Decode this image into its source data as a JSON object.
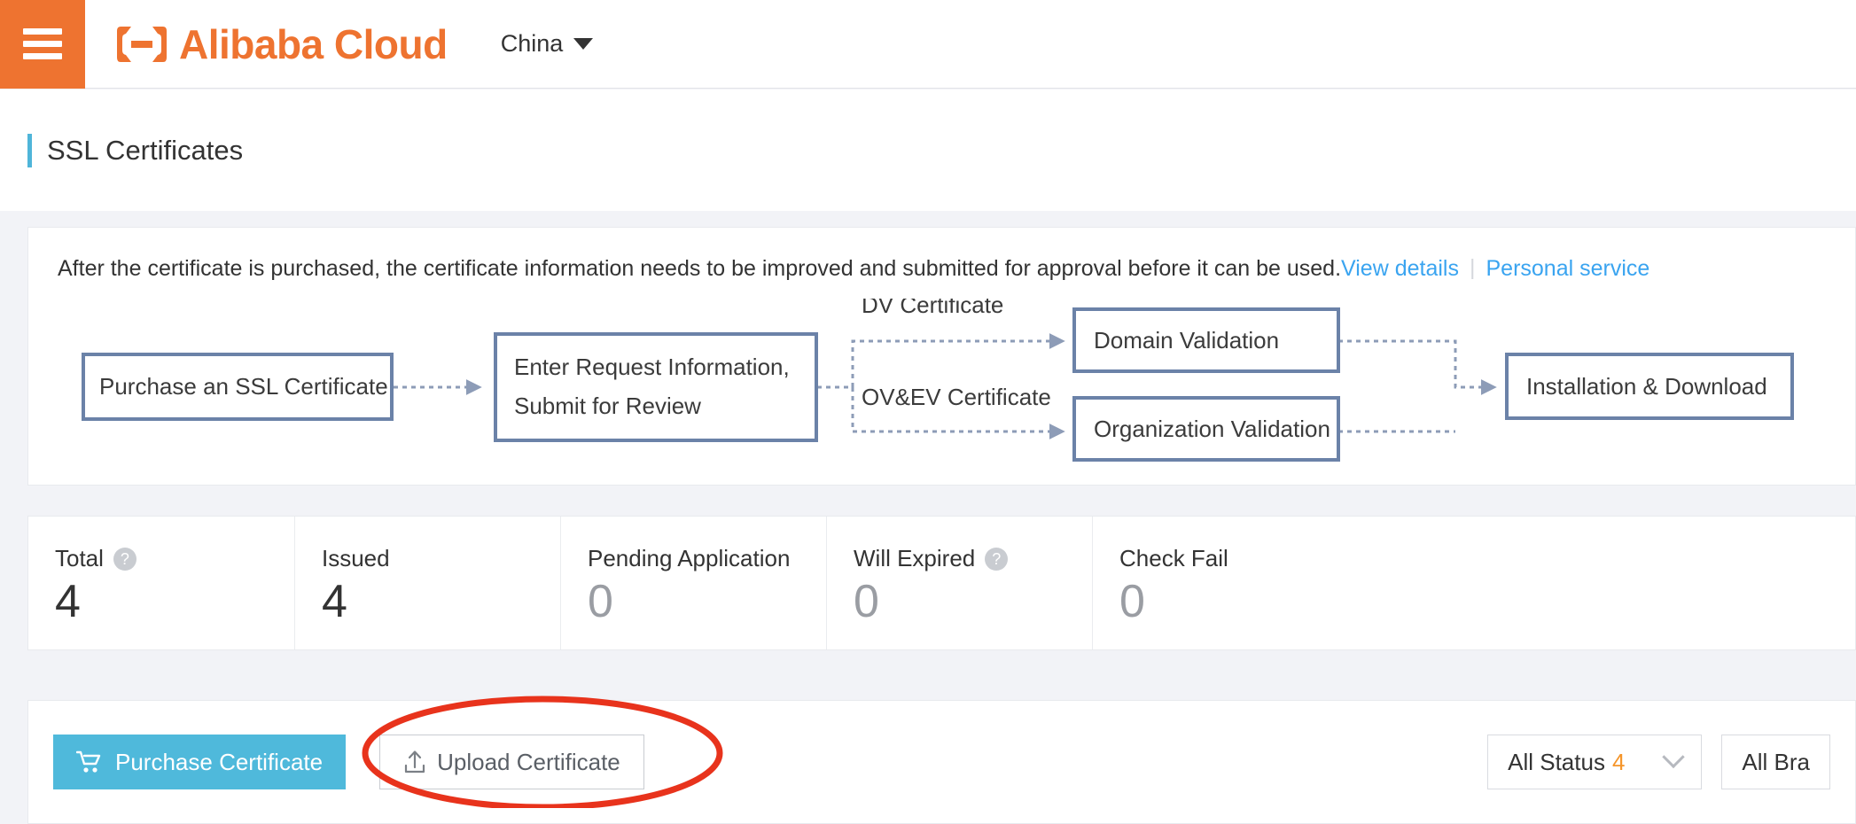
{
  "header": {
    "menu_icon": "hamburger-menu-icon",
    "logo_text": "Alibaba Cloud",
    "logo_mark": "alibaba-cloud-logo-mark",
    "region": "China",
    "region_caret": "chevron-down-icon"
  },
  "page": {
    "title": "SSL Certificates"
  },
  "notice": {
    "text": "After the certificate is purchased, the certificate information needs to be improved and submitted for approval before it can be used.",
    "link_view_details": "View details",
    "separator": "|",
    "link_personal_service": "Personal service"
  },
  "flow": {
    "boxes": [
      {
        "id": "purchase",
        "label": "Purchase an SSL Certificate"
      },
      {
        "id": "enter-request",
        "label_line1": "Enter Request Information,",
        "label_line2": "Submit for Review"
      },
      {
        "id": "domain-validation",
        "label": "Domain Validation"
      },
      {
        "id": "organization-validation",
        "label": "Organization Validation"
      },
      {
        "id": "installation-download",
        "label": "Installation & Download"
      }
    ],
    "branch_labels": {
      "dv": "DV Certificate",
      "ovev": "OV&EV Certificate"
    },
    "border_color": "#6b82a8",
    "connector_color": "#8d9cb7"
  },
  "stats": [
    {
      "label": "Total",
      "value": "4",
      "help": true,
      "dim": false
    },
    {
      "label": "Issued",
      "value": "4",
      "help": false,
      "dim": false
    },
    {
      "label": "Pending Application",
      "value": "0",
      "help": false,
      "dim": true
    },
    {
      "label": "Will Expired",
      "value": "0",
      "help": true,
      "dim": true
    },
    {
      "label": "Check Fail",
      "value": "0",
      "help": false,
      "dim": true
    }
  ],
  "help_glyph": "?",
  "toolbar": {
    "purchase_label": "Purchase Certificate",
    "purchase_icon": "shopping-cart-icon",
    "upload_label": "Upload Certificate",
    "upload_icon": "upload-icon",
    "status_filter": {
      "label": "All Status",
      "count": "4",
      "caret": "chevron-down-icon"
    },
    "brand_filter": {
      "label": "All Bra",
      "caret": "chevron-down-icon"
    }
  },
  "annotation": {
    "shape": "red-ellipse-highlight",
    "color": "#e8331c",
    "target": "upload-certificate-button"
  },
  "colors": {
    "brand_orange": "#ee7330",
    "accent_blue": "#4fb5d9",
    "link_blue": "#3aa4f0",
    "page_bg": "#f2f3f7",
    "count_orange": "#f5952a"
  }
}
